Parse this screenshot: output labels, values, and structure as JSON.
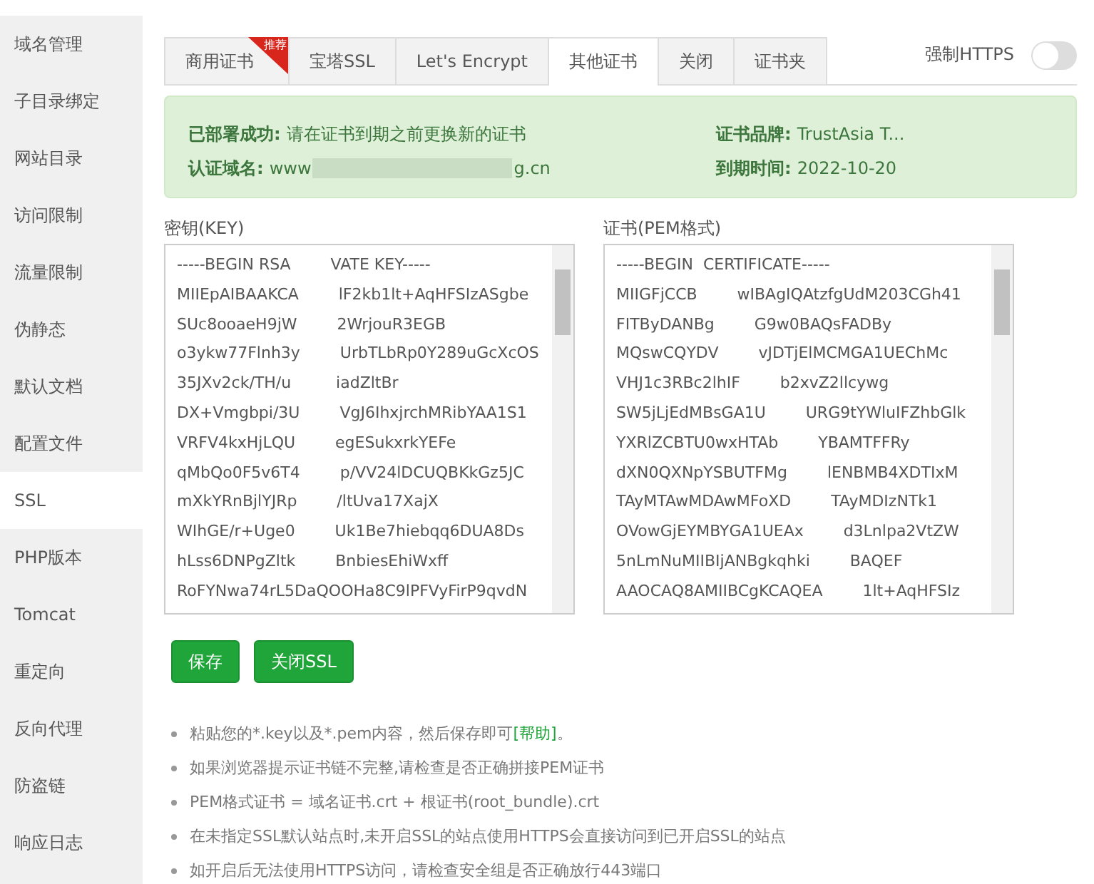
{
  "sidebar": {
    "items": [
      {
        "label": "域名管理",
        "selected": false
      },
      {
        "label": "子目录绑定",
        "selected": false
      },
      {
        "label": "网站目录",
        "selected": false
      },
      {
        "label": "访问限制",
        "selected": false
      },
      {
        "label": "流量限制",
        "selected": false
      },
      {
        "label": "伪静态",
        "selected": false
      },
      {
        "label": "默认文档",
        "selected": false
      },
      {
        "label": "配置文件",
        "selected": false
      },
      {
        "label": "SSL",
        "selected": true
      },
      {
        "label": "PHP版本",
        "selected": false
      },
      {
        "label": "Tomcat",
        "selected": false
      },
      {
        "label": "重定向",
        "selected": false
      },
      {
        "label": "反向代理",
        "selected": false
      },
      {
        "label": "防盗链",
        "selected": false
      },
      {
        "label": "响应日志",
        "selected": false
      }
    ]
  },
  "tabs": [
    {
      "label": "商用证书",
      "selected": false,
      "badge": "推荐"
    },
    {
      "label": "宝塔SSL",
      "selected": false
    },
    {
      "label": "Let's Encrypt",
      "selected": false
    },
    {
      "label": "其他证书",
      "selected": true
    },
    {
      "label": "关闭",
      "selected": false
    },
    {
      "label": "证书夹",
      "selected": false
    }
  ],
  "force_https": {
    "label": "强制HTTPS",
    "on": false
  },
  "status": {
    "deployed_label": "已部署成功:",
    "deployed_text": "请在证书到期之前更换新的证书",
    "domain_label": "认证域名:",
    "domain_start": "www",
    "domain_end": "g.cn",
    "brand_label": "证书品牌:",
    "brand_value": "TrustAsia T...",
    "expiry_label": "到期时间:",
    "expiry_value": "2022-10-20"
  },
  "key": {
    "label": "密钥(KEY)",
    "lines": [
      "-----BEGIN RSA        VATE KEY-----",
      "MIIEpAIBAAKCA        lF2kb1lt+AqHFSIzASgbe",
      "SUc8ooaeH9jW        2WrjouR3EGB",
      "o3ykw77Flnh3y        UrbTLbRp0Y289uGcXcOS",
      "35JXv2ck/TH/u         iadZltBr",
      "DX+Vmgbpi/3U        VgJ6IhxjrchMRibYAA1S1",
      "VRFV4kxHjLQU        egESukxrkYEFe",
      "qMbQo0F5v6T4        p/VV24lDCUQBKkGz5JC",
      "mXkYRnBjlYJRp        /ltUva17XajX",
      "WIhGE/r+Uge0        Uk1Be7hiebqq6DUA8Ds",
      "hLss6DNPgZltk        BnbiesEhiWxff",
      "RoFYNwa74rL5DaQOOHa8C9lPFVyFirP9qvdN"
    ]
  },
  "cert": {
    "label": "证书(PEM格式)",
    "lines": [
      "-----BEGIN  CERTIFICATE-----",
      "MIIGFjCCB        wIBAgIQAtzfgUdM203CGh41",
      "FITByDANBg        G9w0BAQsFADBy",
      "MQswCQYDV        vJDTjElMCMGA1UEChMc",
      "VHJ1c3RBc2lhIF        b2xvZ2llcywg",
      "SW5jLjEdMBsGA1U        URG9tYWluIFZhbGlk",
      "YXRlZCBTU0wxHTAb        YBAMTFFRy",
      "dXN0QXNpYSBUTFMg        lENBMB4XDTIxM",
      "TAyMTAwMDAwMFoXD        TAyMDIzNTk1",
      "OVowGjEYMBYGA1UEAx        d3Lnlpa2VtZW",
      "5nLmNuMIIBIjANBgkqhki        BAQEF",
      "AAOCAQ8AMIIBCgKCAQEA        1lt+AqHFSIz"
    ]
  },
  "buttons": [
    {
      "label": "保存"
    },
    {
      "label": "关闭SSL"
    }
  ],
  "tips": [
    "粘贴您的*.key以及*.pem内容，然后保存即可**[帮助]**。",
    "如果浏览器提示证书链不完整,请检查是否正确拼接PEM证书",
    "PEM格式证书 = 域名证书.crt + 根证书(root_bundle).crt",
    "在未指定SSL默认站点时,未开启SSL的站点使用HTTPS会直接访问到已开启SSL的站点",
    "如开启后无法使用HTTPS访问，请检查安全组是否正确放行443端口"
  ]
}
